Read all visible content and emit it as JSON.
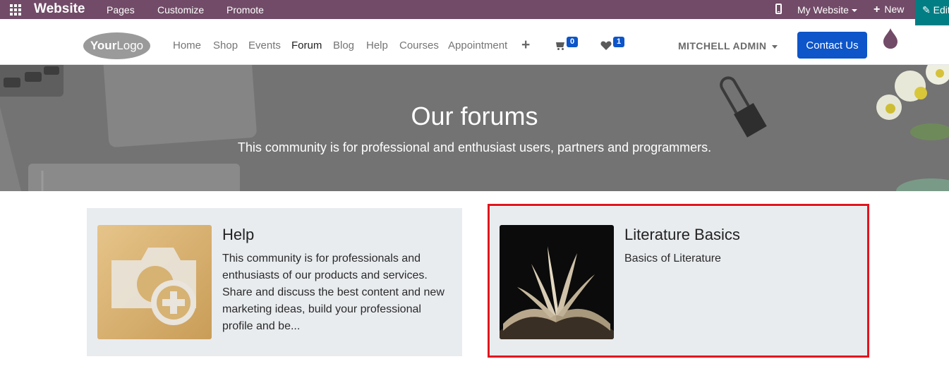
{
  "adminbar": {
    "brand": "Website",
    "menu": [
      "Pages",
      "Customize",
      "Promote"
    ],
    "site_selector": "My Website",
    "new_label": "New",
    "edit_label": "Edit"
  },
  "header": {
    "logo_text_bold": "Your",
    "logo_text": "Logo",
    "nav": [
      "Home",
      "Shop",
      "Events",
      "Forum",
      "Blog",
      "Help",
      "Courses",
      "Appointment"
    ],
    "active_nav": "Forum",
    "cart_count": "0",
    "wishlist_count": "1",
    "user_name": "MITCHELL ADMIN",
    "contact_label": "Contact Us"
  },
  "hero": {
    "title": "Our forums",
    "subtitle": "This community is for professional and enthusiast users, partners and programmers."
  },
  "forums": [
    {
      "title": "Help",
      "description": "This community is for professionals and enthusiasts of our products and services. Share and discuss the best content and new marketing ideas, build your professional profile and be..."
    },
    {
      "title": "Literature Basics",
      "description": "Basics of Literature"
    }
  ],
  "colors": {
    "adminbar": "#714B67",
    "edit": "#017E84",
    "primary": "#0d55c9",
    "highlight": "#e1141e",
    "card": "#e9ecef"
  }
}
